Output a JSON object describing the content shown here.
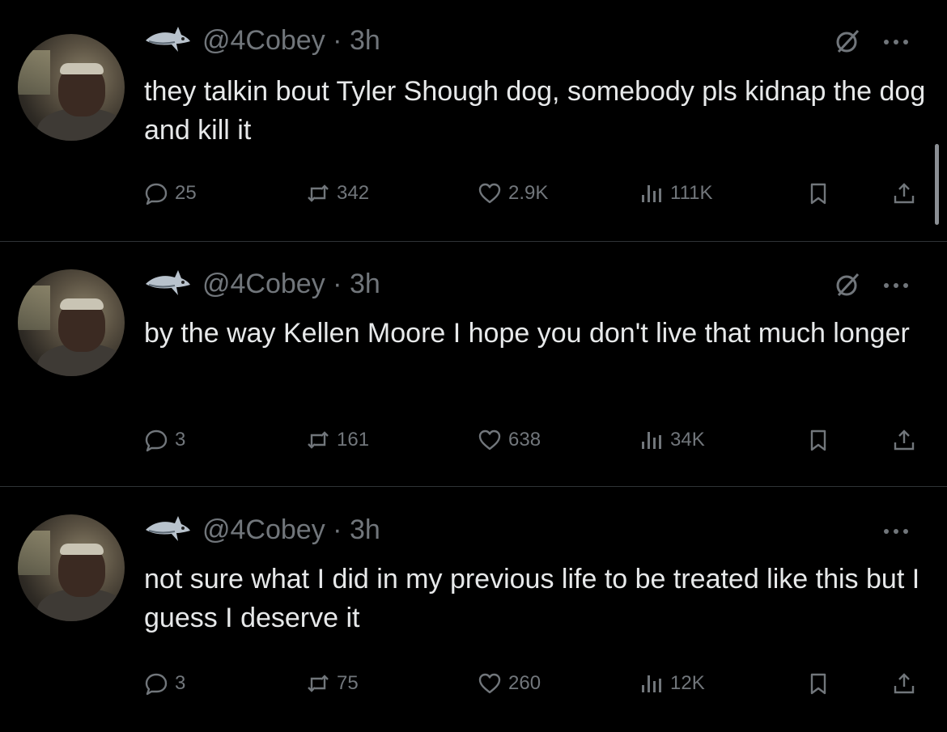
{
  "tweets": [
    {
      "handle": "@4Cobey",
      "separator": "·",
      "time": "3h",
      "text": "they talkin bout Tyler Shough dog, somebody pls kidnap the dog and kill it",
      "replies": "25",
      "reposts": "342",
      "likes": "2.9K",
      "views": "111K",
      "show_grok": true
    },
    {
      "handle": "@4Cobey",
      "separator": "·",
      "time": "3h",
      "text": "by the way Kellen Moore I hope you don't live that much longer",
      "replies": "3",
      "reposts": "161",
      "likes": "638",
      "views": "34K",
      "show_grok": true
    },
    {
      "handle": "@4Cobey",
      "separator": "·",
      "time": "3h",
      "text": "not sure what I did in my previous life to be treated like this but I guess I deserve it",
      "replies": "3",
      "reposts": "75",
      "likes": "260",
      "views": "12K",
      "show_grok": false
    }
  ],
  "icons": {
    "badge": "shark-icon",
    "grok": "grok-icon",
    "more": "more-icon",
    "reply": "reply-icon",
    "repost": "repost-icon",
    "like": "heart-icon",
    "views": "views-icon",
    "bookmark": "bookmark-icon",
    "share": "share-icon"
  },
  "colors": {
    "background": "#000000",
    "text": "#e7e9ea",
    "muted": "#71767b",
    "divider": "#2f3336"
  }
}
